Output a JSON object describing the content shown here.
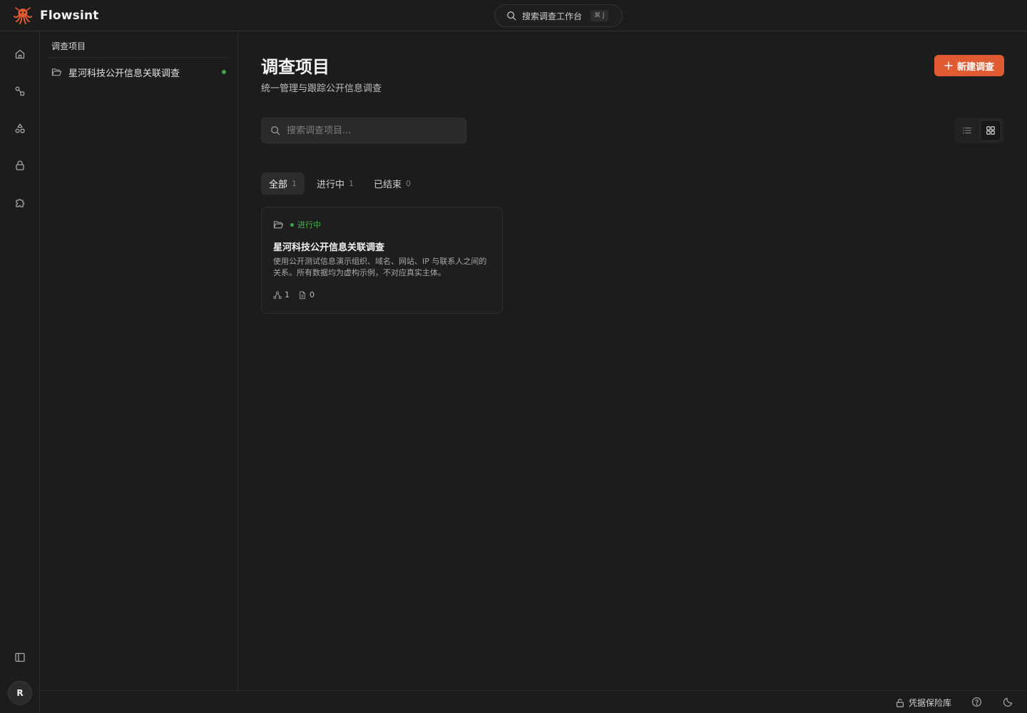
{
  "app": {
    "name": "Flowsint",
    "brand_color": "#e05a32"
  },
  "command_search": {
    "label": "搜索调查工作台",
    "shortcut": "⌘ J"
  },
  "rail": {
    "items": [
      "home-icon",
      "flows-icon",
      "shapes-icon",
      "lock-icon",
      "puzzle-icon"
    ],
    "bottom": [
      "panel-toggle-icon"
    ],
    "avatar_initial": "R"
  },
  "sidebar": {
    "title": "调查项目",
    "items": [
      {
        "label": "星河科技公开信息关联调查",
        "status_color": "#3fa34d"
      }
    ]
  },
  "main": {
    "title": "调查项目",
    "subtitle": "统一管理与跟踪公开信息调查",
    "new_button": "新建调查",
    "search_placeholder": "搜索调查项目...",
    "view_modes": [
      "list",
      "grid"
    ],
    "active_view": "grid",
    "tabs": [
      {
        "label": "全部",
        "count": "1"
      },
      {
        "label": "进行中",
        "count": "1"
      },
      {
        "label": "已结束",
        "count": "0"
      }
    ],
    "cards": [
      {
        "status": "进行中",
        "title": "星河科技公开信息关联调查",
        "description": "使用公开测试信息演示组织、域名、网站、IP 与联系人之间的关系。所有数据均为虚构示例，不对应真实主体。",
        "graphs": "1",
        "documents": "0"
      }
    ]
  },
  "footer": {
    "vault_label": "凭据保险库"
  }
}
